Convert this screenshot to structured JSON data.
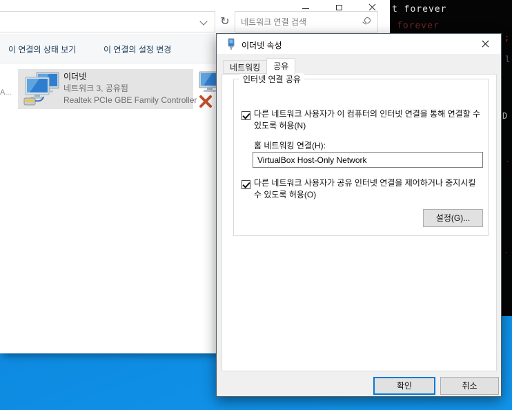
{
  "colors": {
    "accent": "#0078d7",
    "desktop_blue": "#0d86dc",
    "dialog_bg": "#f0f0f0",
    "selection_bg": "#e4e4e4",
    "terminal_bg": "#050505",
    "error_x_red": "#c1512b"
  },
  "icons": {
    "refresh_glyph": "↻",
    "names": [
      "minimize-icon",
      "maximize-icon",
      "close-icon",
      "chevron-down-icon",
      "refresh-icon",
      "search-icon",
      "network-adapter-icon",
      "ethernet-connection-icon",
      "disconnected-x-icon"
    ]
  },
  "terminal": {
    "line1": "t forever",
    "line2": "forever",
    "edge_chars": [
      {
        "ch": ";"
      },
      {
        "ch": "l"
      },
      {
        "ch": "D"
      },
      {
        "ch": "."
      },
      {
        "ch": "."
      }
    ]
  },
  "explorer": {
    "search": {
      "placeholder": "네트워크 연결 검색"
    },
    "commandbar": {
      "items": [
        "이 연결의 상태 보기",
        "이 연결의 설정 변경"
      ]
    },
    "truncated_item_label": "A...",
    "connection": {
      "name": "이더넷",
      "status": "네트워크 3, 공유됨",
      "device": "Realtek PCIe GBE Family Controller"
    }
  },
  "dialog": {
    "title": "이더넷 속성",
    "tabs": [
      {
        "label": "네트워킹",
        "active": false
      },
      {
        "label": "공유",
        "active": true
      }
    ],
    "group_title": "인터넷 연결 공유",
    "checkbox1": {
      "label": "다른 네트워크 사용자가 이 컴퓨터의 인터넷 연결을 통해 연결할 수 있도록 허용(N)",
      "checked": true
    },
    "home_net_label": "홈 네트워킹 연결(H):",
    "home_net_value": "VirtualBox Host-Only Network",
    "checkbox2": {
      "label": "다른 네트워크 사용자가 공유 인터넷 연결을 제어하거나 중지시킬 수 있도록 허용(O)",
      "checked": true
    },
    "settings_button": "설정(G)...",
    "ok_button": "확인",
    "cancel_button": "취소"
  }
}
